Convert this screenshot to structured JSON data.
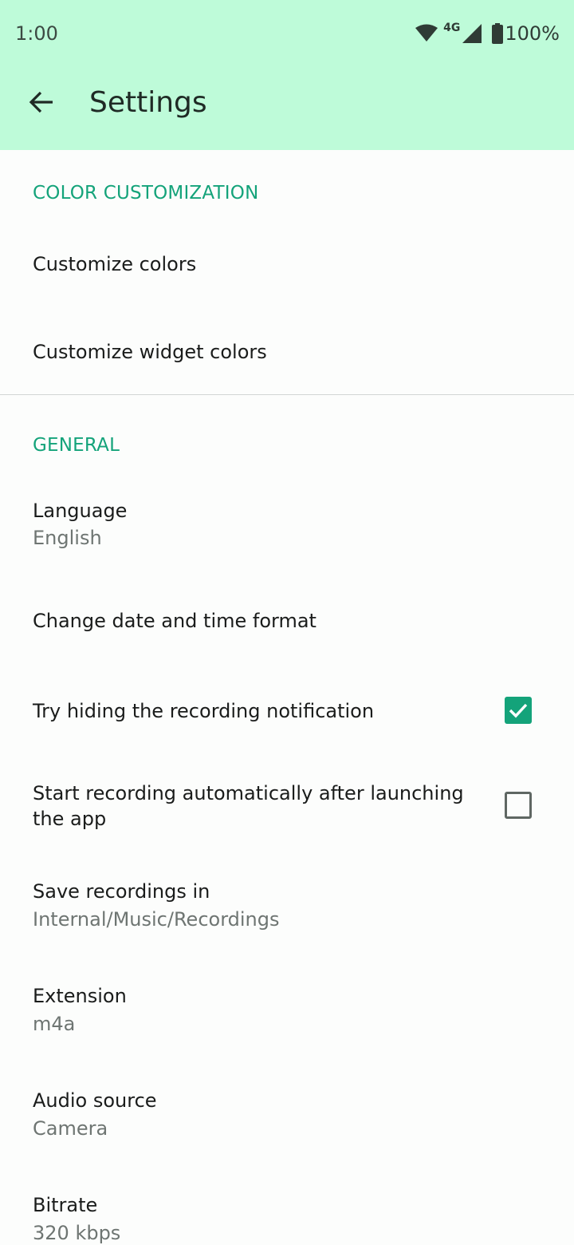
{
  "status_bar": {
    "time": "1:00",
    "network": "4G",
    "battery": "100%",
    "icons": [
      "wifi-icon",
      "cell-signal-icon",
      "battery-icon"
    ]
  },
  "app_bar": {
    "title": "Settings",
    "back_icon": "arrow-back-icon"
  },
  "colors": {
    "app_bar_bg": "#befbd9",
    "accent": "#14a37a",
    "background": "#fcfdfc"
  },
  "sections": {
    "color": {
      "header": "COLOR CUSTOMIZATION",
      "customize_colors": "Customize colors",
      "customize_widget_colors": "Customize widget colors"
    },
    "general": {
      "header": "GENERAL",
      "language": {
        "title": "Language",
        "value": "English"
      },
      "date_format": {
        "title": "Change date and time format"
      },
      "hide_notification": {
        "title": "Try hiding the recording notification",
        "checked": true
      },
      "auto_start": {
        "title": "Start recording automatically after launching the app",
        "checked": false
      },
      "save_path": {
        "title": "Save recordings in",
        "value": "Internal/Music/Recordings"
      },
      "extension": {
        "title": "Extension",
        "value": "m4a"
      },
      "audio_source": {
        "title": "Audio source",
        "value": "Camera"
      },
      "bitrate": {
        "title": "Bitrate",
        "value": "320 kbps"
      }
    }
  }
}
